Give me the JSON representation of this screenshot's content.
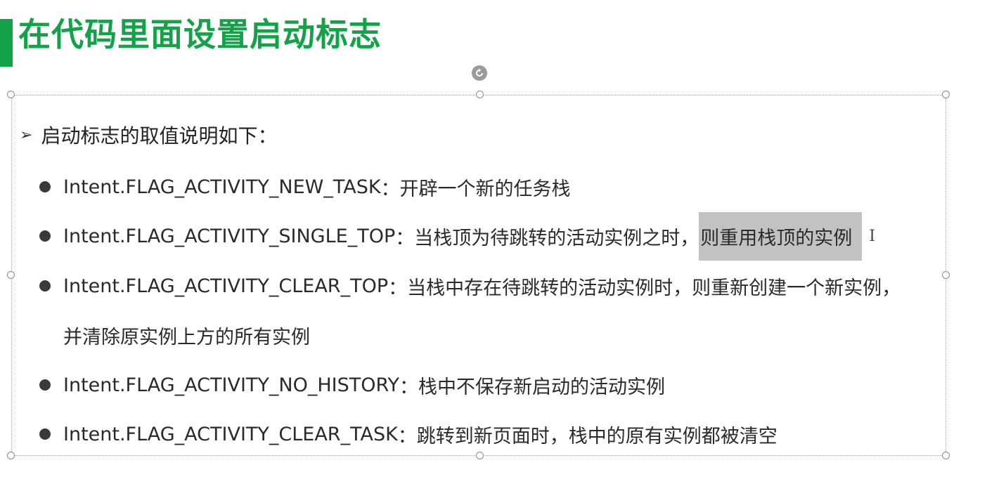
{
  "slide": {
    "title": "在代码里面设置启动标志",
    "accent_color": "#13a247",
    "heading": "启动标志的取值说明如下：",
    "heading_marker_icon": "arrow-right-icon",
    "bullet_icon": "filled-circle-icon",
    "items": [
      {
        "flag": "Intent.FLAG_ACTIVITY_NEW_TASK",
        "desc": "：开辟一个新的任务栈"
      },
      {
        "flag": "Intent.FLAG_ACTIVITY_SINGLE_TOP",
        "desc": "：当栈顶为待跳转的活动实例之时，",
        "highlight": "则重用栈顶的实例"
      },
      {
        "flag": "Intent.FLAG_ACTIVITY_CLEAR_TOP",
        "desc": "：当栈中存在待跳转的活动实例时，则重新创建一个新实例，",
        "continuation": "并清除原实例上方的所有实例"
      },
      {
        "flag": "Intent.FLAG_ACTIVITY_NO_HISTORY",
        "desc": "：栈中不保存新启动的活动实例"
      },
      {
        "flag": "Intent.FLAG_ACTIVITY_CLEAR_TASK",
        "desc": "：跳转到新页面时，栈中的原有实例都被清空"
      }
    ]
  }
}
